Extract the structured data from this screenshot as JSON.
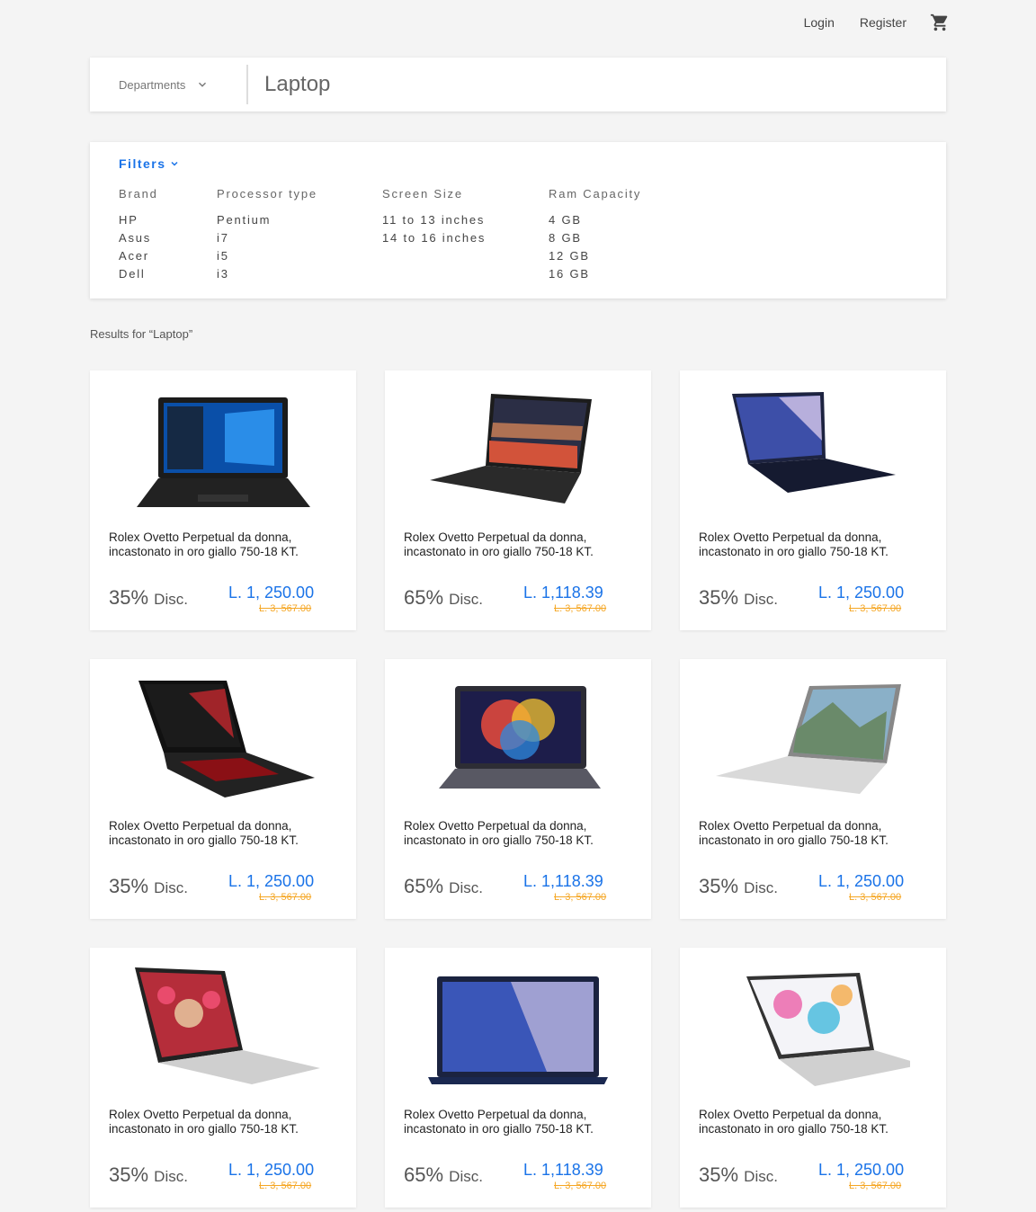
{
  "nav": {
    "login": "Login",
    "register": "Register"
  },
  "search": {
    "department_label": "Departments",
    "query": "Laptop"
  },
  "filters": {
    "toggle_label": "Filters",
    "groups": [
      {
        "title": "Brand",
        "options": [
          "HP",
          "Asus",
          "Acer",
          "Dell"
        ]
      },
      {
        "title": "Processor type",
        "options": [
          "Pentium",
          "i7",
          "i5",
          "i3"
        ]
      },
      {
        "title": "Screen Size",
        "options": [
          "11 to 13 inches",
          "14 to 16 inches"
        ]
      },
      {
        "title": "Ram Capacity",
        "options": [
          "4 GB",
          "8 GB",
          "12 GB",
          "16 GB"
        ]
      }
    ]
  },
  "results_heading": "Results for “Laptop”",
  "colors": {
    "accent": "#1a73e8",
    "strike": "#f5a623"
  },
  "products": [
    {
      "title": "Rolex Ovetto Perpetual da donna, incastonato in oro giallo 750-18 KT.",
      "discount": "35%",
      "disc_word": "Disc.",
      "price": "L. 1, 250.00",
      "old_price": "L. 3, 567.00",
      "image": "black-laptop-windows-blue"
    },
    {
      "title": "Rolex Ovetto Perpetual da donna, incastonato in oro giallo 750-18 KT.",
      "discount": "65%",
      "disc_word": "Disc.",
      "price": "L. 1,118.39",
      "old_price": "L. 3, 567.00",
      "image": "black-laptop-sunset"
    },
    {
      "title": "Rolex Ovetto Perpetual da donna, incastonato in oro giallo 750-18 KT.",
      "discount": "35%",
      "disc_word": "Disc.",
      "price": "L. 1, 250.00",
      "old_price": "L. 3, 567.00",
      "image": "navy-laptop-zenbook"
    },
    {
      "title": "Rolex Ovetto Perpetual da donna, incastonato in oro giallo 750-18 KT.",
      "discount": "35%",
      "disc_word": "Disc.",
      "price": "L. 1, 250.00",
      "old_price": "L. 3, 567.00",
      "image": "gaming-laptop-red"
    },
    {
      "title": "Rolex Ovetto Perpetual da donna, incastonato in oro giallo 750-18 KT.",
      "discount": "65%",
      "disc_word": "Disc.",
      "price": "L. 1,118.39",
      "old_price": "L. 3, 567.00",
      "image": "grey-laptop-colorful"
    },
    {
      "title": "Rolex Ovetto Perpetual da donna, incastonato in oro giallo 750-18 KT.",
      "discount": "35%",
      "disc_word": "Disc.",
      "price": "L. 1, 250.00",
      "old_price": "L. 3, 567.00",
      "image": "silver-laptop-mountains"
    },
    {
      "title": "Rolex Ovetto Perpetual da donna, incastonato in oro giallo 750-18 KT.",
      "discount": "35%",
      "disc_word": "Disc.",
      "price": "L. 1, 250.00",
      "old_price": "L. 3, 567.00",
      "image": "silver-laptop-flowers"
    },
    {
      "title": "Rolex Ovetto Perpetual da donna, incastonato in oro giallo 750-18 KT.",
      "discount": "65%",
      "disc_word": "Disc.",
      "price": "L. 1,118.39",
      "old_price": "L. 3, 567.00",
      "image": "zenbook-front"
    },
    {
      "title": "Rolex Ovetto Perpetual da donna, incastonato in oro giallo 750-18 KT.",
      "discount": "35%",
      "disc_word": "Disc.",
      "price": "L. 1, 250.00",
      "old_price": "L. 3, 567.00",
      "image": "silver-laptop-paint"
    }
  ]
}
